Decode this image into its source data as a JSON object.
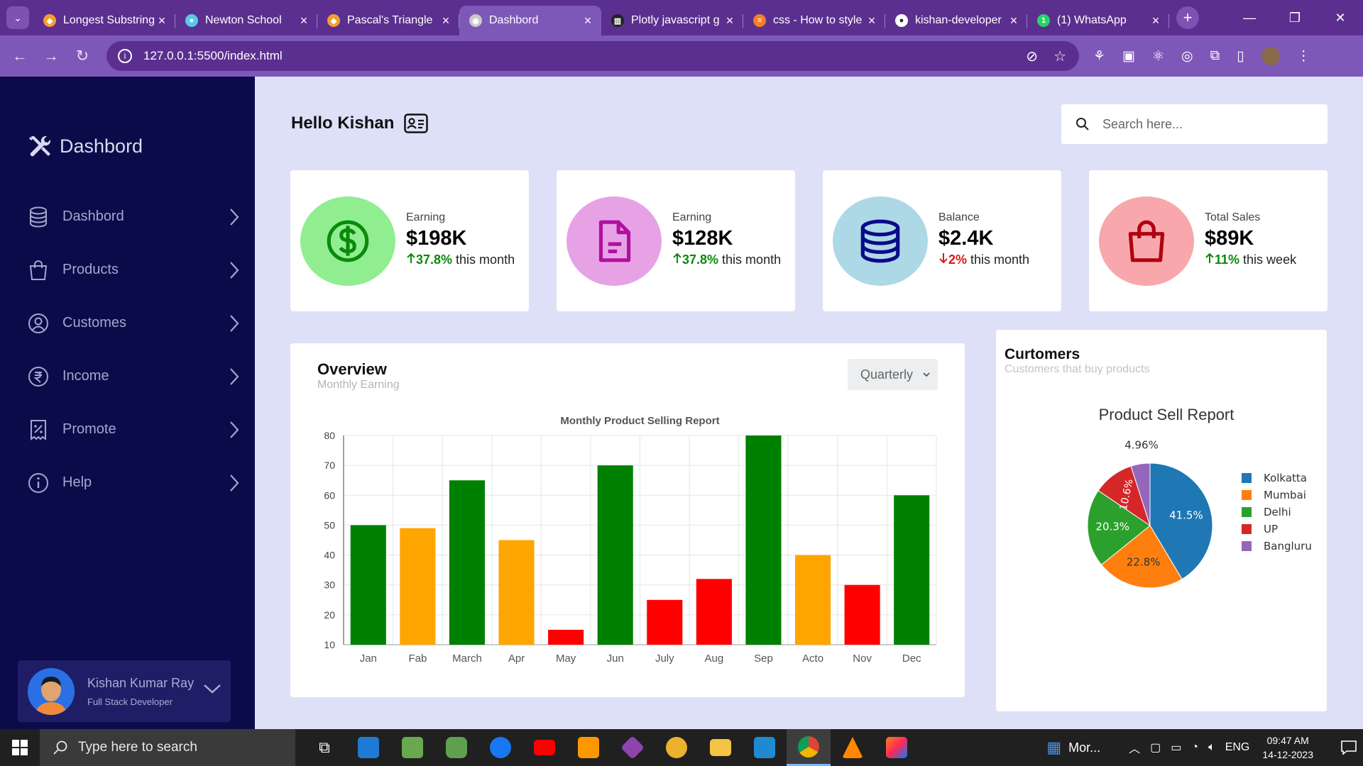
{
  "browser": {
    "tabs": [
      {
        "title": "Longest Substring",
        "color": "#f0a030",
        "glyph": "◆"
      },
      {
        "title": "Newton School",
        "color": "#5cc8e8",
        "glyph": "●"
      },
      {
        "title": "Pascal's Triangle",
        "color": "#f0a030",
        "glyph": "◆"
      },
      {
        "title": "Dashbord",
        "color": "#c9c9c9",
        "glyph": "◉"
      },
      {
        "title": "Plotly javascript g",
        "color": "#222222",
        "glyph": "▥"
      },
      {
        "title": "css - How to style",
        "color": "#f48024",
        "glyph": "≡"
      },
      {
        "title": "kishan-developer",
        "color": "#ffffff",
        "glyph": "●"
      },
      {
        "title": "(1) WhatsApp",
        "color": "#25d366",
        "glyph": "1"
      }
    ],
    "url": "127.0.0.1:5500/index.html"
  },
  "sidebar": {
    "brand": "Dashbord",
    "items": [
      {
        "label": "Dashbord",
        "icon": "database-icon"
      },
      {
        "label": "Products",
        "icon": "bag-icon"
      },
      {
        "label": "Customes",
        "icon": "user-circle-icon"
      },
      {
        "label": "Income",
        "icon": "rupee-icon"
      },
      {
        "label": "Promote",
        "icon": "discount-icon"
      },
      {
        "label": "Help",
        "icon": "info-icon"
      }
    ],
    "profile": {
      "name": "Kishan Kumar Ray",
      "role": "Full Stack Developer"
    }
  },
  "header": {
    "greeting": "Hello Kishan",
    "search_placeholder": "Search here..."
  },
  "cards": [
    {
      "label": "Earning",
      "value": "$198K",
      "pct": "37.8%",
      "suffix": " this month",
      "dir": "up",
      "circle": "#90ee90",
      "iconColor": "#0a8a0a",
      "icon": "dollar-icon"
    },
    {
      "label": "Earning",
      "value": "$128K",
      "pct": "37.8%",
      "suffix": " this month",
      "dir": "up",
      "circle": "#e7a2e6",
      "iconColor": "#b0109e",
      "icon": "document-icon"
    },
    {
      "label": "Balance",
      "value": "$2.4K",
      "pct": "2%",
      "suffix": " this month",
      "dir": "down",
      "circle": "#add8e6",
      "iconColor": "#0a0a8a",
      "icon": "coins-icon"
    },
    {
      "label": "Total Sales",
      "value": "$89K",
      "pct": "11%",
      "suffix": " this week",
      "dir": "up",
      "circle": "#f8a8ac",
      "iconColor": "#b00010",
      "icon": "shopping-bag-icon"
    }
  ],
  "overview": {
    "title": "Overview",
    "subtitle": "Monthly Earning",
    "select_value": "Quarterly"
  },
  "customers": {
    "title": "Curtomers",
    "subtitle": "Customers that buy products"
  },
  "chart_data": [
    {
      "type": "bar",
      "title": "Monthly Product Selling Report",
      "categories": [
        "Jan",
        "Fab",
        "March",
        "Apr",
        "May",
        "Jun",
        "July",
        "Aug",
        "Sep",
        "Acto",
        "Nov",
        "Dec"
      ],
      "values": [
        50,
        49,
        65,
        45,
        15,
        70,
        25,
        32,
        80,
        40,
        30,
        60
      ],
      "colors": [
        "#008000",
        "#ffa500",
        "#008000",
        "#ffa500",
        "#ff0000",
        "#008000",
        "#ff0000",
        "#ff0000",
        "#008000",
        "#ffa500",
        "#ff0000",
        "#008000"
      ],
      "yticks": [
        10,
        20,
        30,
        40,
        50,
        60,
        70,
        80
      ],
      "ylim": [
        10,
        80
      ],
      "grid": true
    },
    {
      "type": "pie",
      "title": "Product Sell Report",
      "labels": [
        "Kolkatta",
        "Mumbai",
        "Delhi",
        "UP",
        "Bangluru"
      ],
      "percent_labels": [
        "41.5%",
        "22.8%",
        "20.3%",
        "10.6%",
        "4.96%"
      ],
      "values": [
        41.5,
        22.8,
        20.3,
        10.6,
        4.96
      ],
      "colors": [
        "#1f77b4",
        "#ff7f0e",
        "#2ca02c",
        "#d62728",
        "#9467bd"
      ],
      "legend": "right"
    }
  ],
  "taskbar": {
    "search_placeholder": "Type here to search",
    "news": "Mor...",
    "lang": "ENG",
    "time": "09:47 AM",
    "date": "14-12-2023"
  }
}
